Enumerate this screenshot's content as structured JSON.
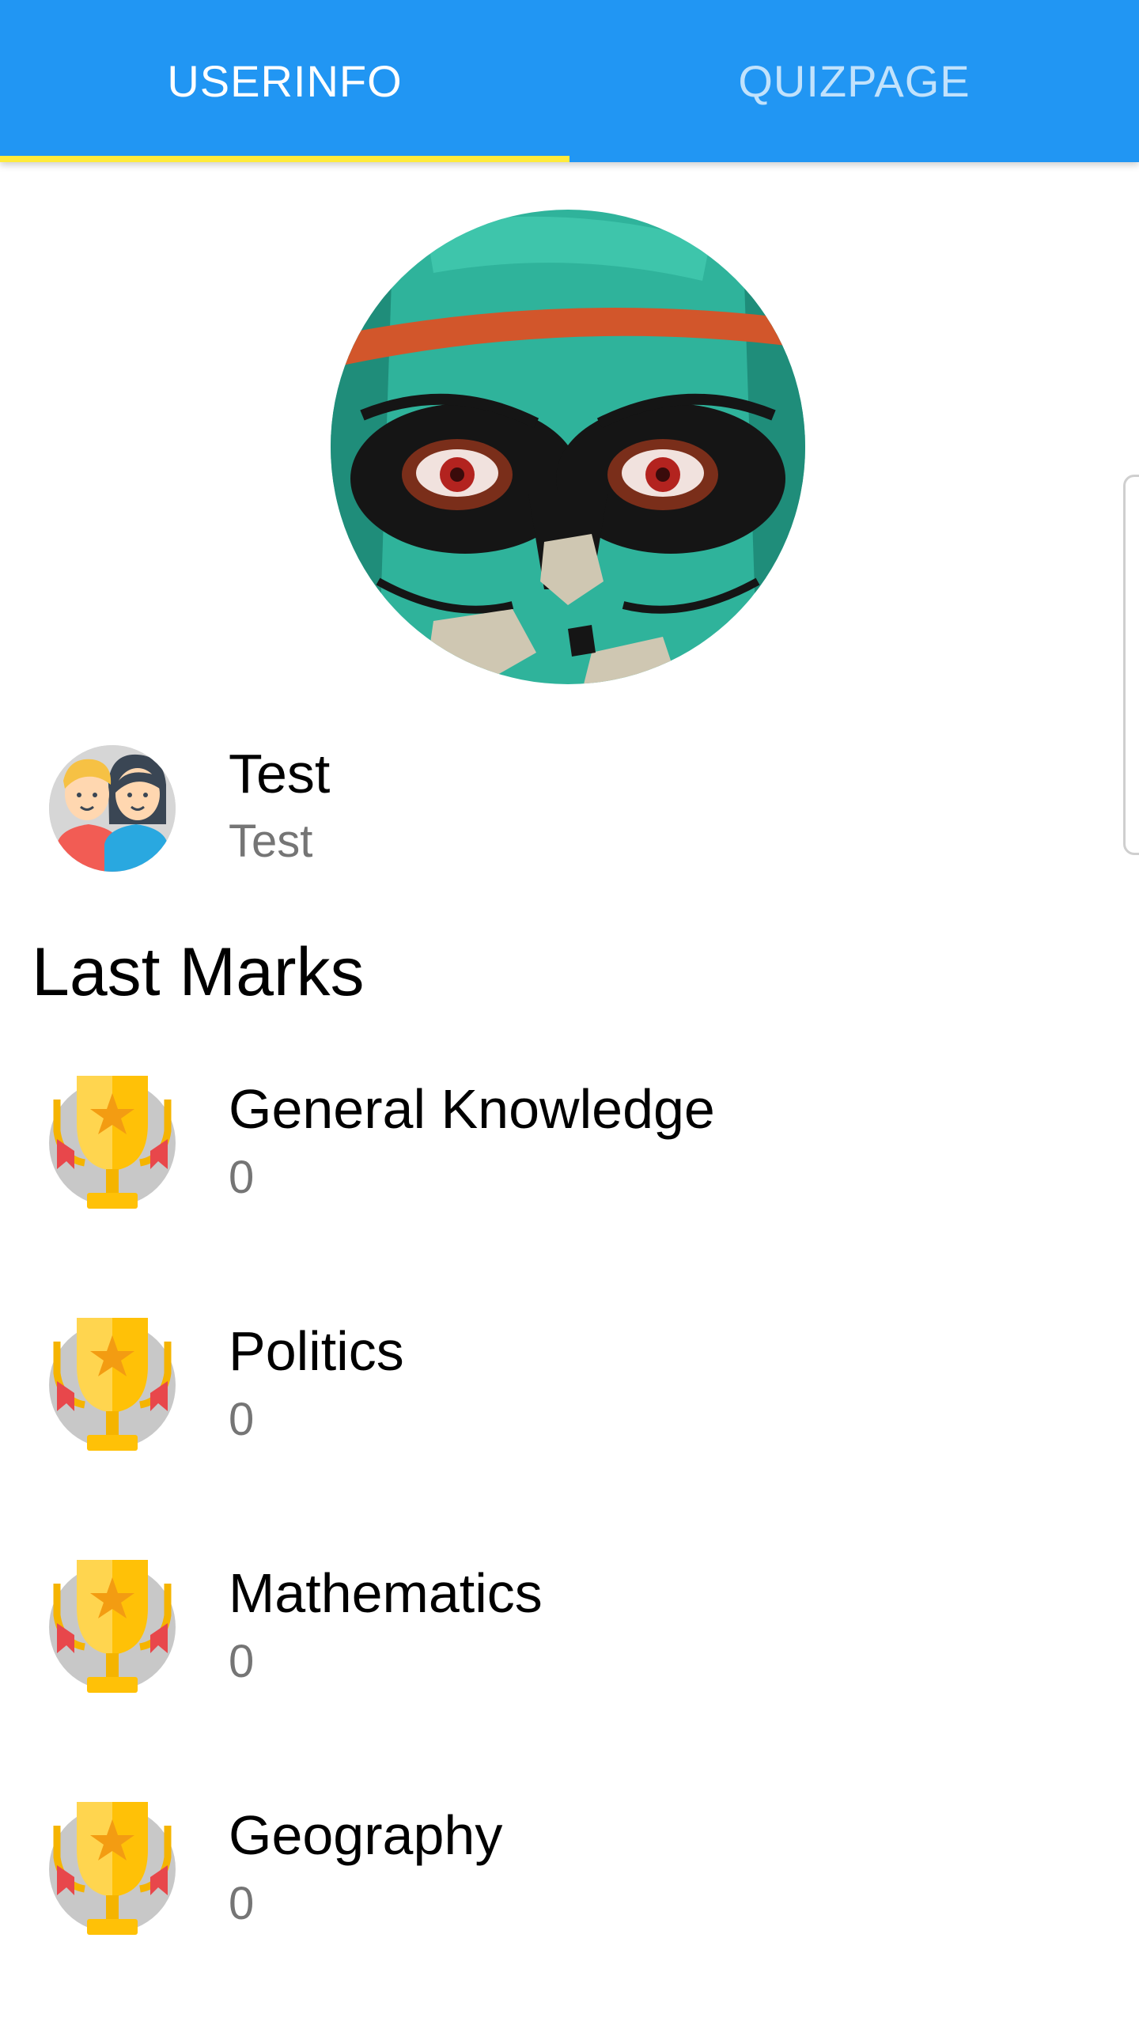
{
  "tabs": [
    {
      "label": "USERINFO",
      "active": true
    },
    {
      "label": "QUIZPAGE",
      "active": false
    }
  ],
  "colors": {
    "app_bar": "#2196F3",
    "tab_indicator": "#FFEB3B",
    "subtitle_text": "#757575"
  },
  "user": {
    "name": "Test",
    "subtitle": "Test",
    "avatar_icon": "couple-avatar-icon",
    "profile_image": "graffiti-skull-profile-picture"
  },
  "last_marks": {
    "heading": "Last Marks",
    "icon": "trophy-icon",
    "items": [
      {
        "category": "General Knowledge",
        "score": "0"
      },
      {
        "category": "Politics",
        "score": "0"
      },
      {
        "category": "Mathematics",
        "score": "0"
      },
      {
        "category": "Geography",
        "score": "0"
      }
    ]
  }
}
